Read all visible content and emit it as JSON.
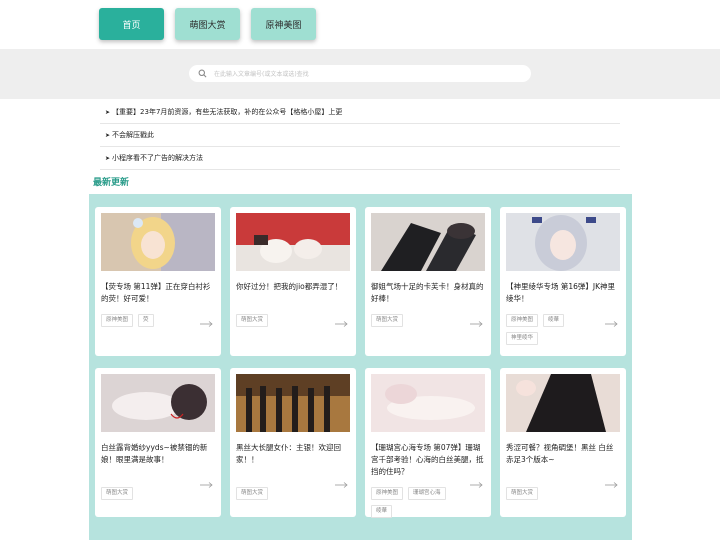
{
  "nav": {
    "items": [
      {
        "label": "首页",
        "active": true
      },
      {
        "label": "萌图大赏",
        "active": false
      },
      {
        "label": "原神美图",
        "active": false
      }
    ]
  },
  "search": {
    "placeholder": "在此输入文章编号(或文本或选)查找"
  },
  "notices": [
    {
      "text": "【重要】23年7月前资源，有些无法获取，补的在公众号【格格小屋】上更"
    },
    {
      "text": "不会解压戳此"
    },
    {
      "text": "小程序看不了广告的解决方法"
    }
  ],
  "section": {
    "title": "最新更新"
  },
  "cards": [
    {
      "title": "【荧专场 第11弹】正在穿白衬衫的荧！好可爱！",
      "tags": [
        "原神美图",
        "荧"
      ]
    },
    {
      "title": "你好过分！把我的jio都弄湿了！",
      "tags": [
        "萌图大赏"
      ]
    },
    {
      "title": "御姐气场十足的卡芙卡！身材真的好棒！",
      "tags": [
        "萌图大赏"
      ]
    },
    {
      "title": "【神里绫华专场 第16弹】JK神里绫华！",
      "tags": [
        "原神美图",
        "绫華",
        "神里绫华"
      ]
    },
    {
      "title": "白丝露背婚纱yyds~被禁锢的新娘！眼里满是故事！",
      "tags": [
        "萌图大赏"
      ]
    },
    {
      "title": "黑丝大长腿女仆：主银！欢迎回家！！",
      "tags": [
        "萌图大赏"
      ]
    },
    {
      "title": "【珊瑚宫心海专场 第07弹】珊瑚宫千部考验！心海的白丝美腿，抵挡的住吗？",
      "tags": [
        "原神美图",
        "珊瑚宫心海",
        "绫華"
      ]
    },
    {
      "title": "秀涩可餐？视角碉堡！黑丝 白丝 赤足3个版本~",
      "tags": [
        "萌图大赏"
      ]
    }
  ],
  "colors": {
    "accent": "#2ab09c",
    "nav_inactive": "#9fdfd2",
    "grid_bg": "#b6e3de",
    "title_green": "#2a9c8a"
  },
  "icons": {
    "search": "search-icon",
    "arrow": "arrow-right-icon"
  }
}
